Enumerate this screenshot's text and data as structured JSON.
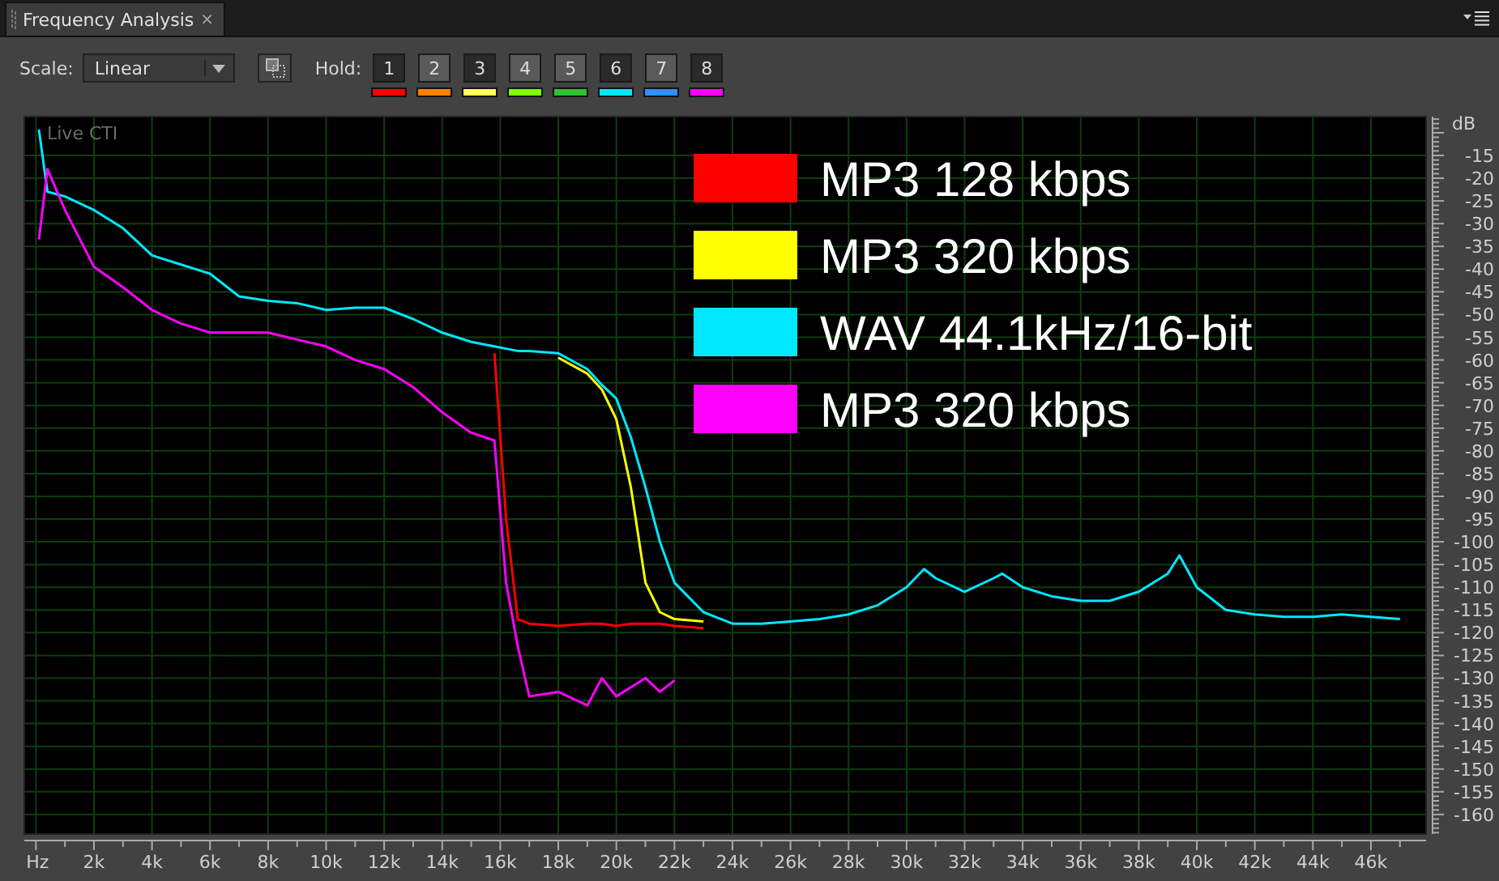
{
  "tab": {
    "title": "Frequency Analysis",
    "close": "×",
    "selected": true
  },
  "toolbar": {
    "scale_label": "Scale:",
    "scale_value": "Linear",
    "hold_label": "Hold:",
    "hold_buttons": [
      {
        "label": "1",
        "selected": true,
        "color": "#ff0000"
      },
      {
        "label": "2",
        "selected": false,
        "color": "#ff8000"
      },
      {
        "label": "3",
        "selected": true,
        "color": "#ffff60"
      },
      {
        "label": "4",
        "selected": false,
        "color": "#80ff00"
      },
      {
        "label": "5",
        "selected": false,
        "color": "#30c030"
      },
      {
        "label": "6",
        "selected": true,
        "color": "#00e8ff"
      },
      {
        "label": "7",
        "selected": false,
        "color": "#3090ff"
      },
      {
        "label": "8",
        "selected": true,
        "color": "#ff00ff"
      }
    ]
  },
  "chart": {
    "overlay_label": "Live CTI",
    "chart_data": {
      "type": "line",
      "ylabel": "dB",
      "xlim": [
        -0.4,
        47.9
      ],
      "ylim": [
        -164.3,
        -6.45
      ],
      "grid": true,
      "legend": true,
      "x": [
        0.1,
        0.4,
        1,
        2,
        3,
        4,
        5,
        6,
        7,
        8,
        9,
        10,
        11,
        12,
        13,
        14,
        15,
        15.8,
        16.2,
        16.6,
        17,
        18,
        19,
        19.5,
        20,
        20.5,
        21,
        21.5,
        22,
        23,
        24,
        25,
        26,
        27,
        28,
        29,
        30,
        30.6,
        31,
        32,
        33,
        33.3,
        34,
        35,
        36,
        37,
        38,
        39,
        39.4,
        40,
        41,
        42,
        43,
        44,
        45,
        46,
        47
      ],
      "series": [
        {
          "name": "MP3 128 kbps",
          "color": "#ff0000",
          "values": [
            null,
            null,
            null,
            null,
            null,
            null,
            null,
            null,
            null,
            null,
            null,
            null,
            null,
            null,
            null,
            null,
            null,
            -58.5,
            -95,
            -117,
            -118,
            -118.5,
            -118,
            -118,
            -118.5,
            -118,
            -118,
            -118,
            -118.5,
            -119,
            null,
            null,
            null,
            null,
            null,
            null,
            null,
            null,
            null,
            null,
            null,
            null,
            null,
            null,
            null,
            null,
            null,
            null,
            null,
            null,
            null,
            null,
            null,
            null,
            null,
            null,
            null
          ]
        },
        {
          "name": "MP3 320 kbps",
          "color": "#ffff00",
          "values": [
            null,
            null,
            null,
            null,
            null,
            null,
            null,
            null,
            null,
            null,
            null,
            null,
            null,
            null,
            null,
            null,
            null,
            null,
            null,
            null,
            null,
            -59.5,
            -63,
            -66.5,
            -73,
            -88,
            -109,
            -115.5,
            -117,
            -117.5,
            null,
            null,
            null,
            null,
            null,
            null,
            null,
            null,
            null,
            null,
            null,
            null,
            null,
            null,
            null,
            null,
            null,
            null,
            null,
            null,
            null,
            null,
            null,
            null,
            null,
            null,
            null
          ]
        },
        {
          "name": "WAV 44.1kHz/16-bit",
          "color": "#00e8ff",
          "values": [
            -9.3,
            -23,
            -24,
            -27,
            -31,
            -37,
            -39,
            -41,
            -46,
            -47,
            -47.5,
            -49,
            -48.5,
            -48.5,
            -51,
            -54,
            -56,
            -57,
            -57.5,
            -58,
            -58,
            -58.5,
            -62,
            -65.5,
            -68.5,
            -77,
            -88,
            -100,
            -109,
            -115.5,
            -118,
            -118,
            -117.5,
            -117,
            -116,
            -114,
            -110,
            -106,
            -108,
            -111,
            -108,
            -107,
            -110,
            -112,
            -113,
            -113,
            -111,
            -107,
            -103,
            -110,
            -115,
            -116,
            -116.5,
            -116.5,
            -116,
            -116.5,
            -117
          ]
        },
        {
          "name": "MP3 320 kbps",
          "color": "#ff00ff",
          "values": [
            -33.5,
            -18,
            -27,
            -39.5,
            -44,
            -49,
            -52,
            -54,
            -54,
            -54,
            -55.5,
            -57,
            -60,
            -62,
            -66,
            -71.5,
            -76,
            -77.7,
            -109,
            -123,
            -134,
            -133,
            -136,
            -130,
            -134,
            -132,
            -130,
            -133,
            -130.5,
            null,
            null,
            null,
            null,
            null,
            null,
            null,
            null,
            null,
            null,
            null,
            null,
            null,
            null,
            null,
            null,
            null,
            null,
            null,
            null,
            null,
            null,
            null,
            null,
            null,
            null,
            null,
            null
          ]
        }
      ],
      "xticks": [
        {
          "value": 0,
          "label": "Hz"
        },
        {
          "value": 2,
          "label": "2k"
        },
        {
          "value": 4,
          "label": "4k"
        },
        {
          "value": 6,
          "label": "6k"
        },
        {
          "value": 8,
          "label": "8k"
        },
        {
          "value": 10,
          "label": "10k"
        },
        {
          "value": 12,
          "label": "12k"
        },
        {
          "value": 14,
          "label": "14k"
        },
        {
          "value": 16,
          "label": "16k"
        },
        {
          "value": 18,
          "label": "18k"
        },
        {
          "value": 20,
          "label": "20k"
        },
        {
          "value": 22,
          "label": "22k"
        },
        {
          "value": 24,
          "label": "24k"
        },
        {
          "value": 26,
          "label": "26k"
        },
        {
          "value": 28,
          "label": "28k"
        },
        {
          "value": 30,
          "label": "30k"
        },
        {
          "value": 32,
          "label": "32k"
        },
        {
          "value": 34,
          "label": "34k"
        },
        {
          "value": 36,
          "label": "36k"
        },
        {
          "value": 38,
          "label": "38k"
        },
        {
          "value": 40,
          "label": "40k"
        },
        {
          "value": 42,
          "label": "42k"
        },
        {
          "value": 44,
          "label": "44k"
        },
        {
          "value": 46,
          "label": "46k"
        }
      ],
      "yticks": [
        -15,
        -20,
        -25,
        -30,
        -35,
        -40,
        -45,
        -50,
        -55,
        -60,
        -65,
        -70,
        -75,
        -80,
        -85,
        -90,
        -95,
        -100,
        -105,
        -110,
        -115,
        -120,
        -125,
        -130,
        -135,
        -140,
        -145,
        -150,
        -155,
        -160
      ]
    }
  }
}
